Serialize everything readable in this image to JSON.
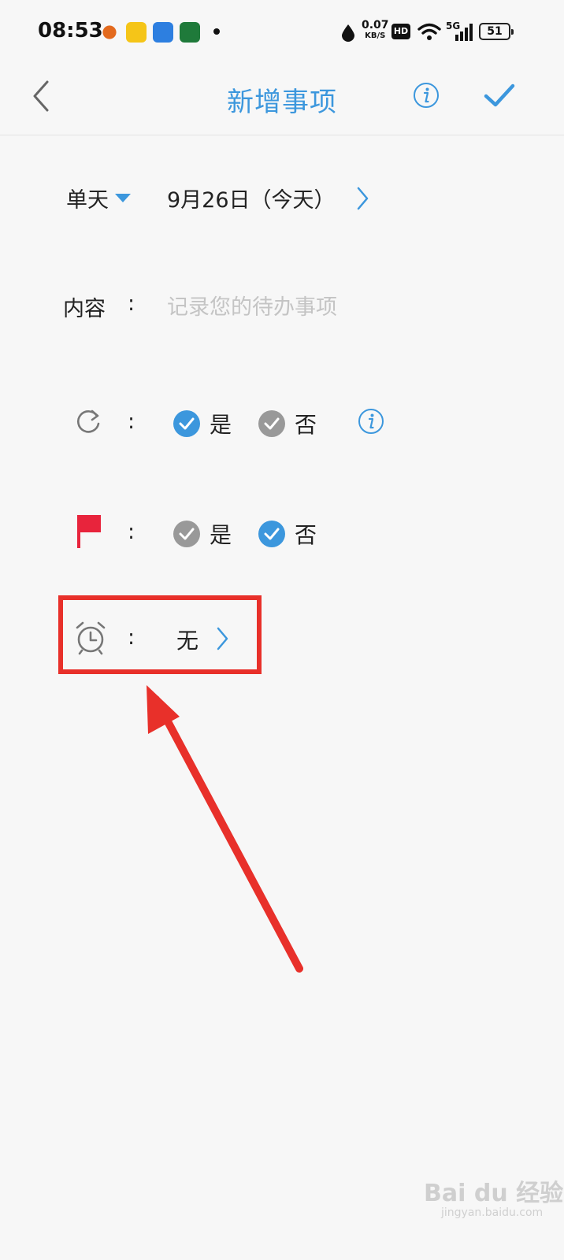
{
  "status": {
    "time": "08:53",
    "net_speed": "0.07",
    "net_unit": "KB/S",
    "hd": "HD",
    "signal": "5G",
    "battery": "51"
  },
  "header": {
    "title": "新增事项"
  },
  "date_row": {
    "mode": "单天",
    "date": "9月26日（今天）"
  },
  "content_row": {
    "label": "内容",
    "colon": ":",
    "placeholder": "记录您的待办事项"
  },
  "repeat_row": {
    "colon": ":",
    "yes_label": "是",
    "no_label": "否",
    "selected": "yes"
  },
  "flag_row": {
    "colon": ":",
    "yes_label": "是",
    "no_label": "否",
    "selected": "no"
  },
  "alarm_row": {
    "colon": ":",
    "value": "无"
  },
  "watermark": {
    "text": "Bai du 经验",
    "sub": "jingyan.baidu.com"
  },
  "colors": {
    "accent": "#3c97dd",
    "flag": "#e8243c",
    "annotation": "#e8302a"
  }
}
